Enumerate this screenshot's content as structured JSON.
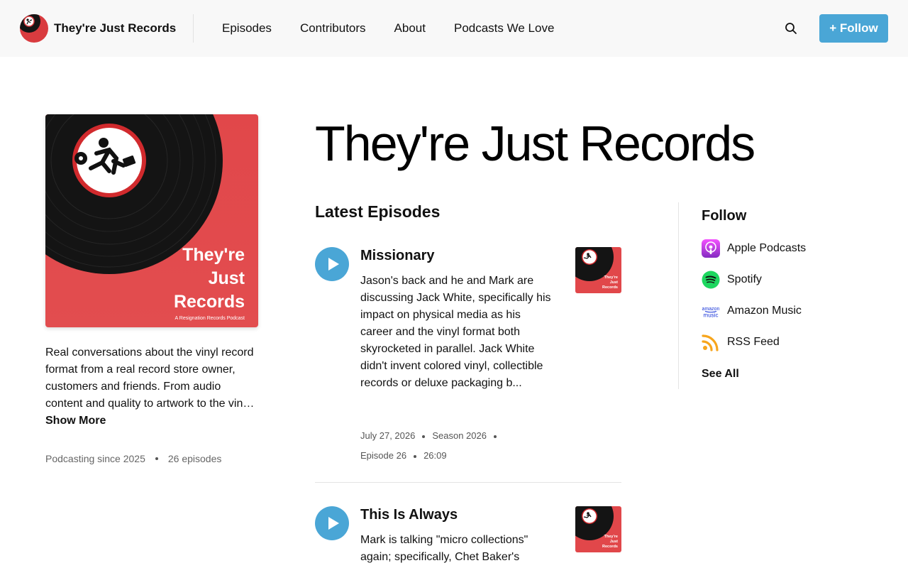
{
  "header": {
    "brand_name": "They're Just Records",
    "nav": [
      "Episodes",
      "Contributors",
      "About",
      "Podcasts We Love"
    ],
    "follow_label": "+ Follow",
    "search_icon": "search-icon"
  },
  "cover": {
    "title_lines": [
      "They're",
      "Just",
      "Records"
    ],
    "subtitle": "A Resignation Records Podcast"
  },
  "podcast": {
    "title": "They're Just Records",
    "description": "Real conversations about the vinyl record format from a real record store owner, customers and friends. From audio content and quality to artwork to the vinyl collecting hobby and everything in between.",
    "show_more_label": "Show More",
    "since": "Podcasting since 2025",
    "episode_count": "26 episodes"
  },
  "main": {
    "latest_heading": "Latest Episodes",
    "episodes": [
      {
        "title": "Missionary",
        "description": "Jason's back and he and Mark are discussing Jack White, specifically his impact on physical media as his career and the vinyl format both skyrocketed in parallel. Jack White didn't invent colored vinyl, collectible records or deluxe packaging b...",
        "date": "July 27, 2026",
        "season": "Season 2026",
        "episode": "Episode 26",
        "duration": "26:09"
      },
      {
        "title": "This Is Always",
        "description": "Mark is talking \"micro collections\" again; specifically, Chet Baker's"
      }
    ]
  },
  "sidebar": {
    "follow_heading": "Follow",
    "platforms": [
      {
        "label": "Apple Podcasts",
        "icon": "apple-podcasts-icon"
      },
      {
        "label": "Spotify",
        "icon": "spotify-icon"
      },
      {
        "label": "Amazon Music",
        "icon": "amazon-music-icon"
      },
      {
        "label": "RSS Feed",
        "icon": "rss-icon"
      }
    ],
    "see_all_label": "See All"
  },
  "colors": {
    "accent": "#4aa6d6",
    "cover_red": "#d93b3f",
    "header_bg": "#f8f8f8"
  }
}
